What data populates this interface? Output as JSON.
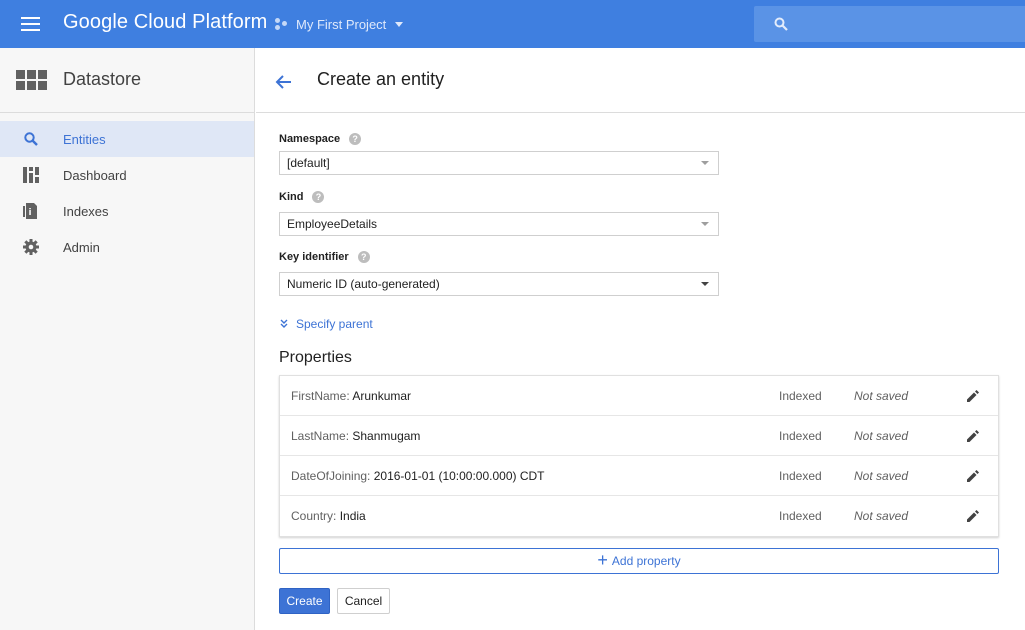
{
  "topbar": {
    "brand": "Google Cloud Platform",
    "project_name": "My First Project",
    "accent_color": "#3f7fe0"
  },
  "sidebar": {
    "title": "Datastore",
    "items": [
      {
        "label": "Entities",
        "icon": "search-icon",
        "active": true
      },
      {
        "label": "Dashboard",
        "icon": "dashboard-icon",
        "active": false
      },
      {
        "label": "Indexes",
        "icon": "indexes-icon",
        "active": false
      },
      {
        "label": "Admin",
        "icon": "gear-icon",
        "active": false
      }
    ]
  },
  "main": {
    "title": "Create an entity",
    "fields": {
      "namespace": {
        "label": "Namespace",
        "value": "[default]"
      },
      "kind": {
        "label": "Kind",
        "value": "EmployeeDetails"
      },
      "key_identifier": {
        "label": "Key identifier",
        "value": "Numeric ID (auto-generated)"
      }
    },
    "specify_parent": "Specify parent",
    "properties_title": "Properties",
    "properties": [
      {
        "name": "FirstName:",
        "value": "Arunkumar",
        "indexed": "Indexed",
        "status": "Not saved"
      },
      {
        "name": "LastName:",
        "value": "Shanmugam",
        "indexed": "Indexed",
        "status": "Not saved"
      },
      {
        "name": "DateOfJoining:",
        "value": "2016-01-01 (10:00:00.000) CDT",
        "indexed": "Indexed",
        "status": "Not saved"
      },
      {
        "name": "Country:",
        "value": "India",
        "indexed": "Indexed",
        "status": "Not saved"
      }
    ],
    "add_property": "Add property",
    "create_button": "Create",
    "cancel_button": "Cancel"
  }
}
